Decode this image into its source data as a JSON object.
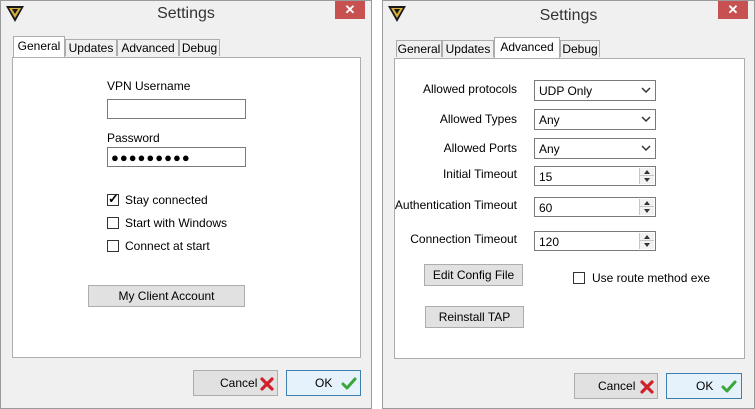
{
  "left": {
    "title": "Settings",
    "close": "✕",
    "tabs": [
      {
        "label": "General",
        "active": true
      },
      {
        "label": "Updates",
        "active": false
      },
      {
        "label": "Advanced",
        "active": false
      },
      {
        "label": "Debug",
        "active": false
      }
    ],
    "vpn_username_label": "VPN Username",
    "vpn_username_value": "",
    "password_label": "Password",
    "password_value": "●●●●●●●●●",
    "stay_connected": {
      "label": "Stay connected",
      "checked": true,
      "mark": "✓"
    },
    "start_with_windows": {
      "label": "Start with Windows",
      "checked": false
    },
    "connect_at_start": {
      "label": "Connect at start",
      "checked": false
    },
    "client_account_button": "My Client Account",
    "cancel_label": "Cancel",
    "ok_label": "OK"
  },
  "right": {
    "title": "Settings",
    "close": "✕",
    "tabs": [
      {
        "label": "General",
        "active": false
      },
      {
        "label": "Updates",
        "active": false
      },
      {
        "label": "Advanced",
        "active": true
      },
      {
        "label": "Debug",
        "active": false
      }
    ],
    "allowed_protocols": {
      "label": "Allowed protocols",
      "value": "UDP Only"
    },
    "allowed_types": {
      "label": "Allowed Types",
      "value": "Any"
    },
    "allowed_ports": {
      "label": "Allowed Ports",
      "value": "Any"
    },
    "initial_timeout": {
      "label": "Initial Timeout",
      "value": "15"
    },
    "auth_timeout": {
      "label": "Authentication Timeout",
      "value": "60"
    },
    "connection_timeout": {
      "label": "Connection Timeout",
      "value": "120"
    },
    "edit_config_button": "Edit Config File",
    "reinstall_tap_button": "Reinstall TAP",
    "use_route_method": {
      "label": "Use route method exe",
      "checked": false
    },
    "cancel_label": "Cancel",
    "ok_label": "OK"
  },
  "colors": {
    "close_bg": "#c75050",
    "cancel_x": "#d0202b",
    "ok_check": "#3aa63a",
    "ok_border": "#3c7fb1"
  },
  "icons": [
    "app-logo-icon",
    "close-icon",
    "cancel-x-icon",
    "ok-check-icon",
    "dropdown-arrow-icon",
    "spin-up-icon",
    "spin-down-icon"
  ]
}
